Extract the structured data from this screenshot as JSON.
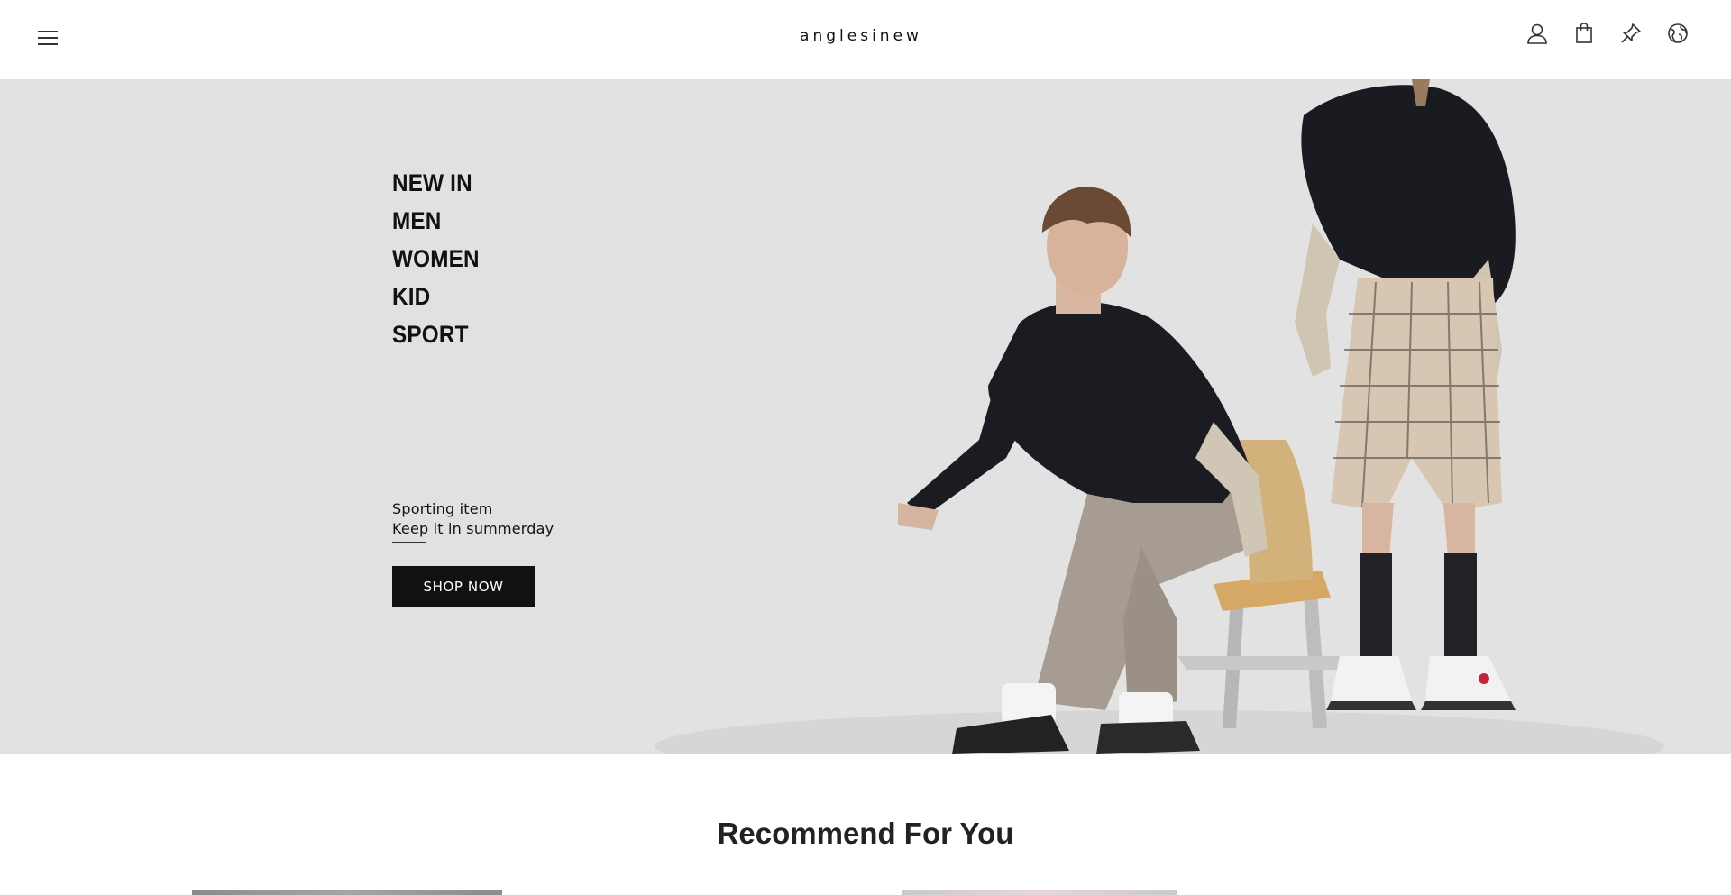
{
  "header": {
    "logo": "anglesinew",
    "icons": [
      "menu-icon",
      "user-icon",
      "shopping-bag-icon",
      "pin-icon",
      "globe-icon"
    ]
  },
  "hero": {
    "categories": [
      "NEW IN",
      "MEN",
      "WOMEN",
      "KID",
      "SPORT"
    ],
    "promo_line_1": "Sporting item",
    "promo_line_2": "Keep it in summerday",
    "cta_label": "SHOP NOW"
  },
  "recommend": {
    "title": "Recommend For You"
  },
  "colors": {
    "hero_background": "#e1e1e1",
    "button_background": "#111111",
    "button_text": "#ffffff"
  }
}
